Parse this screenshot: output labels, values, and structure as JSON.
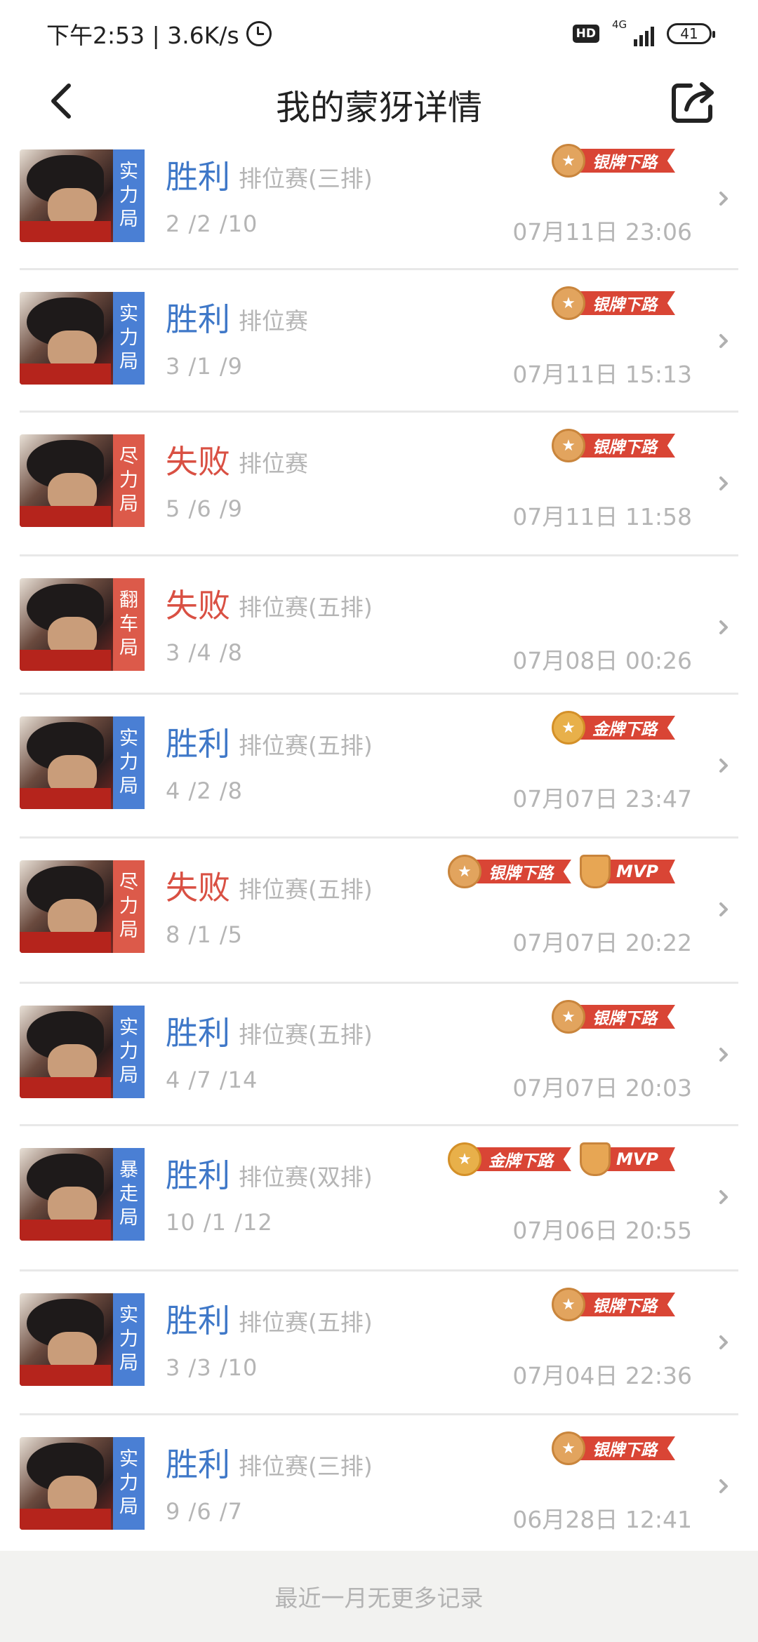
{
  "status_bar": {
    "time_speed": "下午2:53 | 3.6K/s",
    "hd": "HD",
    "network": "4G",
    "battery": "41"
  },
  "header": {
    "title": "我的蒙犽详情"
  },
  "rows": [
    {
      "tag": "实力局",
      "tag_color": "blue",
      "result": "胜利",
      "result_type": "win",
      "mode": "排位赛(三排)",
      "kda": "2 /2 /10",
      "time": "07月11日 23:06",
      "badges": [
        {
          "type": "ribbon",
          "medal": "silver",
          "label": "银牌下路"
        }
      ]
    },
    {
      "tag": "实力局",
      "tag_color": "blue",
      "result": "胜利",
      "result_type": "win",
      "mode": "排位赛",
      "kda": "3 /1 /9",
      "time": "07月11日 15:13",
      "badges": [
        {
          "type": "ribbon",
          "medal": "silver",
          "label": "银牌下路"
        }
      ]
    },
    {
      "tag": "尽力局",
      "tag_color": "red",
      "result": "失败",
      "result_type": "lose",
      "mode": "排位赛",
      "kda": "5 /6 /9",
      "time": "07月11日 11:58",
      "badges": [
        {
          "type": "ribbon",
          "medal": "silver",
          "label": "银牌下路"
        }
      ]
    },
    {
      "tag": "翻车局",
      "tag_color": "red",
      "result": "失败",
      "result_type": "lose",
      "mode": "排位赛(五排)",
      "kda": "3 /4 /8",
      "time": "07月08日 00:26",
      "badges": []
    },
    {
      "tag": "实力局",
      "tag_color": "blue",
      "result": "胜利",
      "result_type": "win",
      "mode": "排位赛(五排)",
      "kda": "4 /2 /8",
      "time": "07月07日 23:47",
      "badges": [
        {
          "type": "ribbon",
          "medal": "gold",
          "label": "金牌下路"
        }
      ]
    },
    {
      "tag": "尽力局",
      "tag_color": "red",
      "result": "失败",
      "result_type": "lose",
      "mode": "排位赛(五排)",
      "kda": "8 /1 /5",
      "time": "07月07日 20:22",
      "badges": [
        {
          "type": "ribbon",
          "medal": "silver",
          "label": "银牌下路"
        },
        {
          "type": "mvp",
          "label": "MVP"
        }
      ]
    },
    {
      "tag": "实力局",
      "tag_color": "blue",
      "result": "胜利",
      "result_type": "win",
      "mode": "排位赛(五排)",
      "kda": "4 /7 /14",
      "time": "07月07日 20:03",
      "badges": [
        {
          "type": "ribbon",
          "medal": "silver",
          "label": "银牌下路"
        }
      ]
    },
    {
      "tag": "暴走局",
      "tag_color": "blue",
      "result": "胜利",
      "result_type": "win",
      "mode": "排位赛(双排)",
      "kda": "10 /1 /12",
      "time": "07月06日 20:55",
      "badges": [
        {
          "type": "ribbon",
          "medal": "gold",
          "label": "金牌下路"
        },
        {
          "type": "mvp",
          "label": "MVP"
        }
      ]
    },
    {
      "tag": "实力局",
      "tag_color": "blue",
      "result": "胜利",
      "result_type": "win",
      "mode": "排位赛(五排)",
      "kda": "3 /3 /10",
      "time": "07月04日 22:36",
      "badges": [
        {
          "type": "ribbon",
          "medal": "silver",
          "label": "银牌下路"
        }
      ]
    },
    {
      "tag": "实力局",
      "tag_color": "blue",
      "result": "胜利",
      "result_type": "win",
      "mode": "排位赛(三排)",
      "kda": "9 /6 /7",
      "time": "06月28日 12:41",
      "badges": [
        {
          "type": "ribbon",
          "medal": "silver",
          "label": "银牌下路"
        }
      ]
    }
  ],
  "footer": {
    "text": "最近一月无更多记录"
  },
  "colors": {
    "win": "#3f78c8",
    "lose": "#d95043",
    "tag_blue": "#4a7fd4",
    "tag_red": "#dc5a4a",
    "ribbon": "#d94535"
  }
}
